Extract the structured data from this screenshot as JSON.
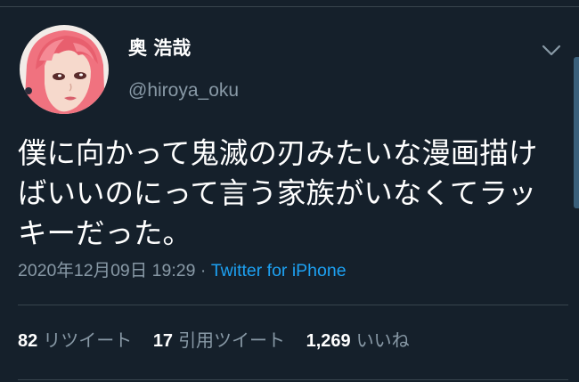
{
  "user": {
    "display_name": "奥 浩哉",
    "handle": "@hiroya_oku"
  },
  "tweet": {
    "lines": [
      "僕に向かって鬼滅の刃みたいな漫画描け",
      "ばいいのにって言う家族がいなくてラッ",
      "キーだった。"
    ],
    "timestamp": "2020年12月09日 19:29",
    "separator": " · ",
    "source": "Twitter for iPhone"
  },
  "stats": {
    "retweets_count": "82",
    "retweets_label": "リツイート",
    "quotes_count": "17",
    "quotes_label": "引用ツイート",
    "likes_count": "1,269",
    "likes_label": "いいね"
  },
  "icons": {
    "menu": "chevron-down-icon"
  },
  "colors": {
    "background": "#15202b",
    "secondary_text": "#8899a6",
    "link": "#1da1f2",
    "divider": "#38444d"
  }
}
